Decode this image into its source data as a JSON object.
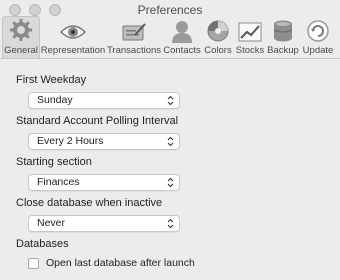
{
  "window": {
    "title": "Preferences"
  },
  "toolbar": {
    "items": [
      {
        "label": "General",
        "icon": "gear-icon",
        "selected": true
      },
      {
        "label": "Representation",
        "icon": "eye-icon"
      },
      {
        "label": "Transactions",
        "icon": "checkbook-icon"
      },
      {
        "label": "Contacts",
        "icon": "person-icon"
      },
      {
        "label": "Colors",
        "icon": "color-wheel-icon"
      },
      {
        "label": "Stocks",
        "icon": "stock-chart-icon"
      },
      {
        "label": "Backup",
        "icon": "database-icon"
      },
      {
        "label": "Update",
        "icon": "refresh-icon"
      }
    ]
  },
  "settings": {
    "first_weekday": {
      "label": "First Weekday",
      "value": "Sunday"
    },
    "polling": {
      "label": "Standard Account Polling Interval",
      "value": "Every 2 Hours"
    },
    "starting_section": {
      "label": "Starting section",
      "value": "Finances"
    },
    "close_db": {
      "label": "Close database when inactive",
      "value": "Never"
    },
    "databases": {
      "label": "Databases",
      "open_last": {
        "label": "Open last database after launch",
        "checked": false
      }
    }
  }
}
